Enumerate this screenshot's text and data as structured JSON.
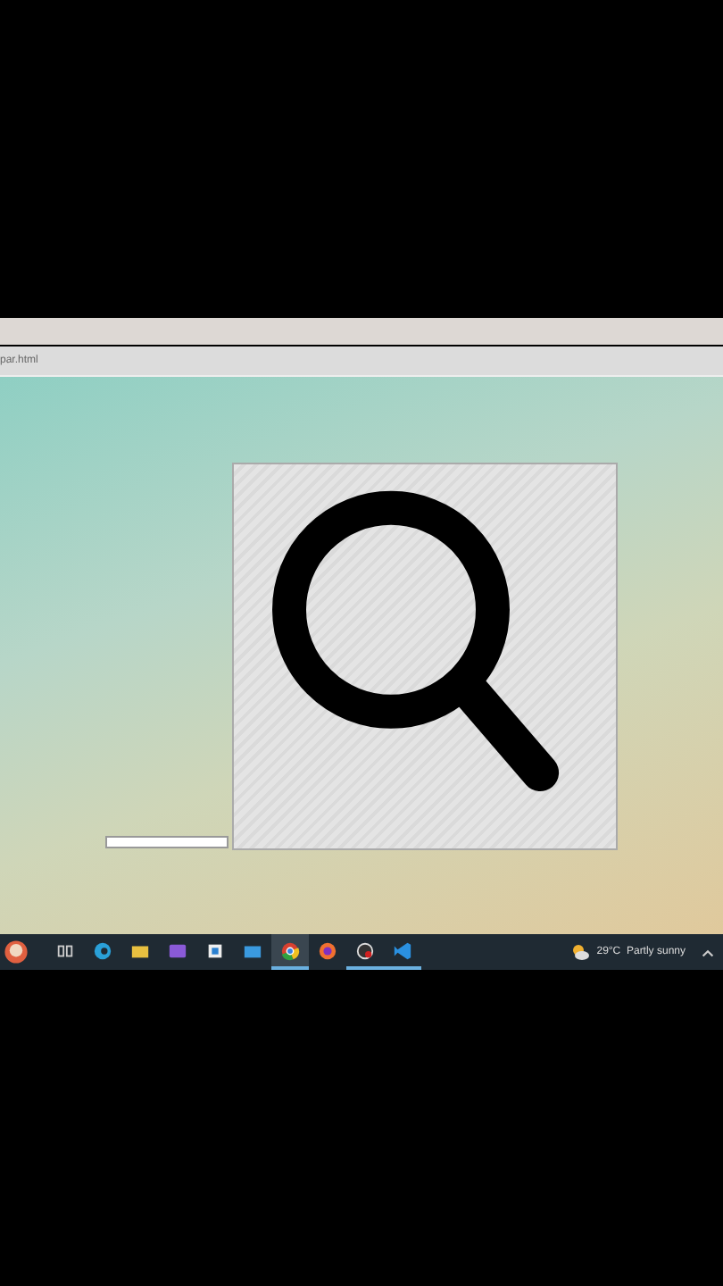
{
  "browser": {
    "address": "par.html"
  },
  "taskbar": {
    "apps": [
      {
        "kind": "taskview",
        "selected": false,
        "running": false
      },
      {
        "kind": "edge",
        "selected": false,
        "running": false
      },
      {
        "kind": "files",
        "selected": false,
        "running": false
      },
      {
        "kind": "purple",
        "selected": false,
        "running": false
      },
      {
        "kind": "store",
        "selected": false,
        "running": false
      },
      {
        "kind": "mail",
        "selected": false,
        "running": false
      },
      {
        "kind": "chrome",
        "selected": true,
        "running": true
      },
      {
        "kind": "firefox",
        "selected": false,
        "running": false
      },
      {
        "kind": "recorder",
        "selected": false,
        "running": true
      },
      {
        "kind": "vscode",
        "selected": false,
        "running": true
      }
    ],
    "weather": "29°C  Partly sunny"
  }
}
